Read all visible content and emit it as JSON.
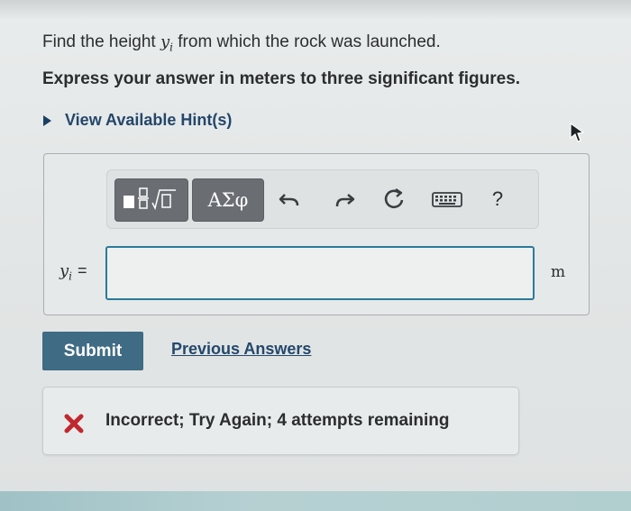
{
  "question": {
    "text_before": "Find the height ",
    "variable": "y",
    "variable_sub": "i",
    "text_after": " from which the rock was launched."
  },
  "instruction": "Express your answer in meters to three significant figures.",
  "hint": {
    "label": "View Available Hint(s)"
  },
  "toolbar": {
    "templates_icon": "templates-icon",
    "symbols_label": "ΑΣφ",
    "undo_icon": "undo-icon",
    "redo_icon": "redo-icon",
    "reset_icon": "reset-icon",
    "keyboard_icon": "keyboard-icon",
    "help_label": "?"
  },
  "answer": {
    "variable": "y",
    "variable_sub": "i",
    "equals": "=",
    "value": "",
    "unit": "m"
  },
  "actions": {
    "submit_label": "Submit",
    "previous_answers_label": "Previous Answers"
  },
  "feedback": {
    "icon": "x-icon",
    "text": "Incorrect; Try Again; 4 attempts remaining",
    "icon_color": "#c0282e"
  },
  "colors": {
    "accent": "#3f6b85",
    "link": "#23486c",
    "input_border": "#2b7a9a"
  }
}
